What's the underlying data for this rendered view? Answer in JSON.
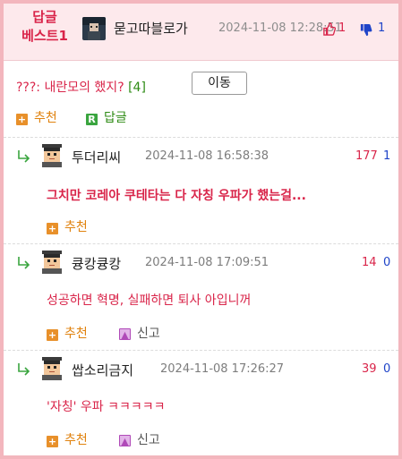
{
  "best": {
    "label_line1": "답글",
    "label_line2": "베스트1",
    "author": "묻고따블로가",
    "date": "2024-11-08 12:28:51",
    "up_count": "1",
    "down_count": "1"
  },
  "post": {
    "title": "???: 내란모의 했지?",
    "comment_count": "[4]",
    "move_label": "이동",
    "recommend_label": "추천",
    "reply_label": "답글"
  },
  "replies": [
    {
      "author": "투더리씨",
      "date": "2024-11-08 16:58:38",
      "up": "177",
      "down": "1",
      "body": "그치만 코레아 쿠테타는 다 자칭 우파가 했는걸...",
      "recommend_label": "추천"
    },
    {
      "author": "큥캉큥캉",
      "date": "2024-11-08 17:09:51",
      "up": "14",
      "down": "0",
      "body": "성공하면 혁명, 실패하면 퇴사 아입니꺼",
      "recommend_label": "추천",
      "report_label": "신고"
    },
    {
      "author": "쌉소리금지",
      "date": "2024-11-08 17:26:27",
      "up": "39",
      "down": "0",
      "body": "'자칭' 우파 ㅋㅋㅋㅋㅋ",
      "recommend_label": "추천",
      "report_label": "신고"
    }
  ],
  "colors": {
    "accent_red": "#d9254a",
    "down_blue": "#1f44c8",
    "recommend_orange": "#e0820e",
    "reply_green": "#2e8b14",
    "frame_pink": "#f3b6bd"
  },
  "icons": [
    "thumbs-up-icon",
    "thumbs-down-icon",
    "plus-icon",
    "reply-r-icon",
    "report-icon",
    "reply-arrow-icon"
  ]
}
